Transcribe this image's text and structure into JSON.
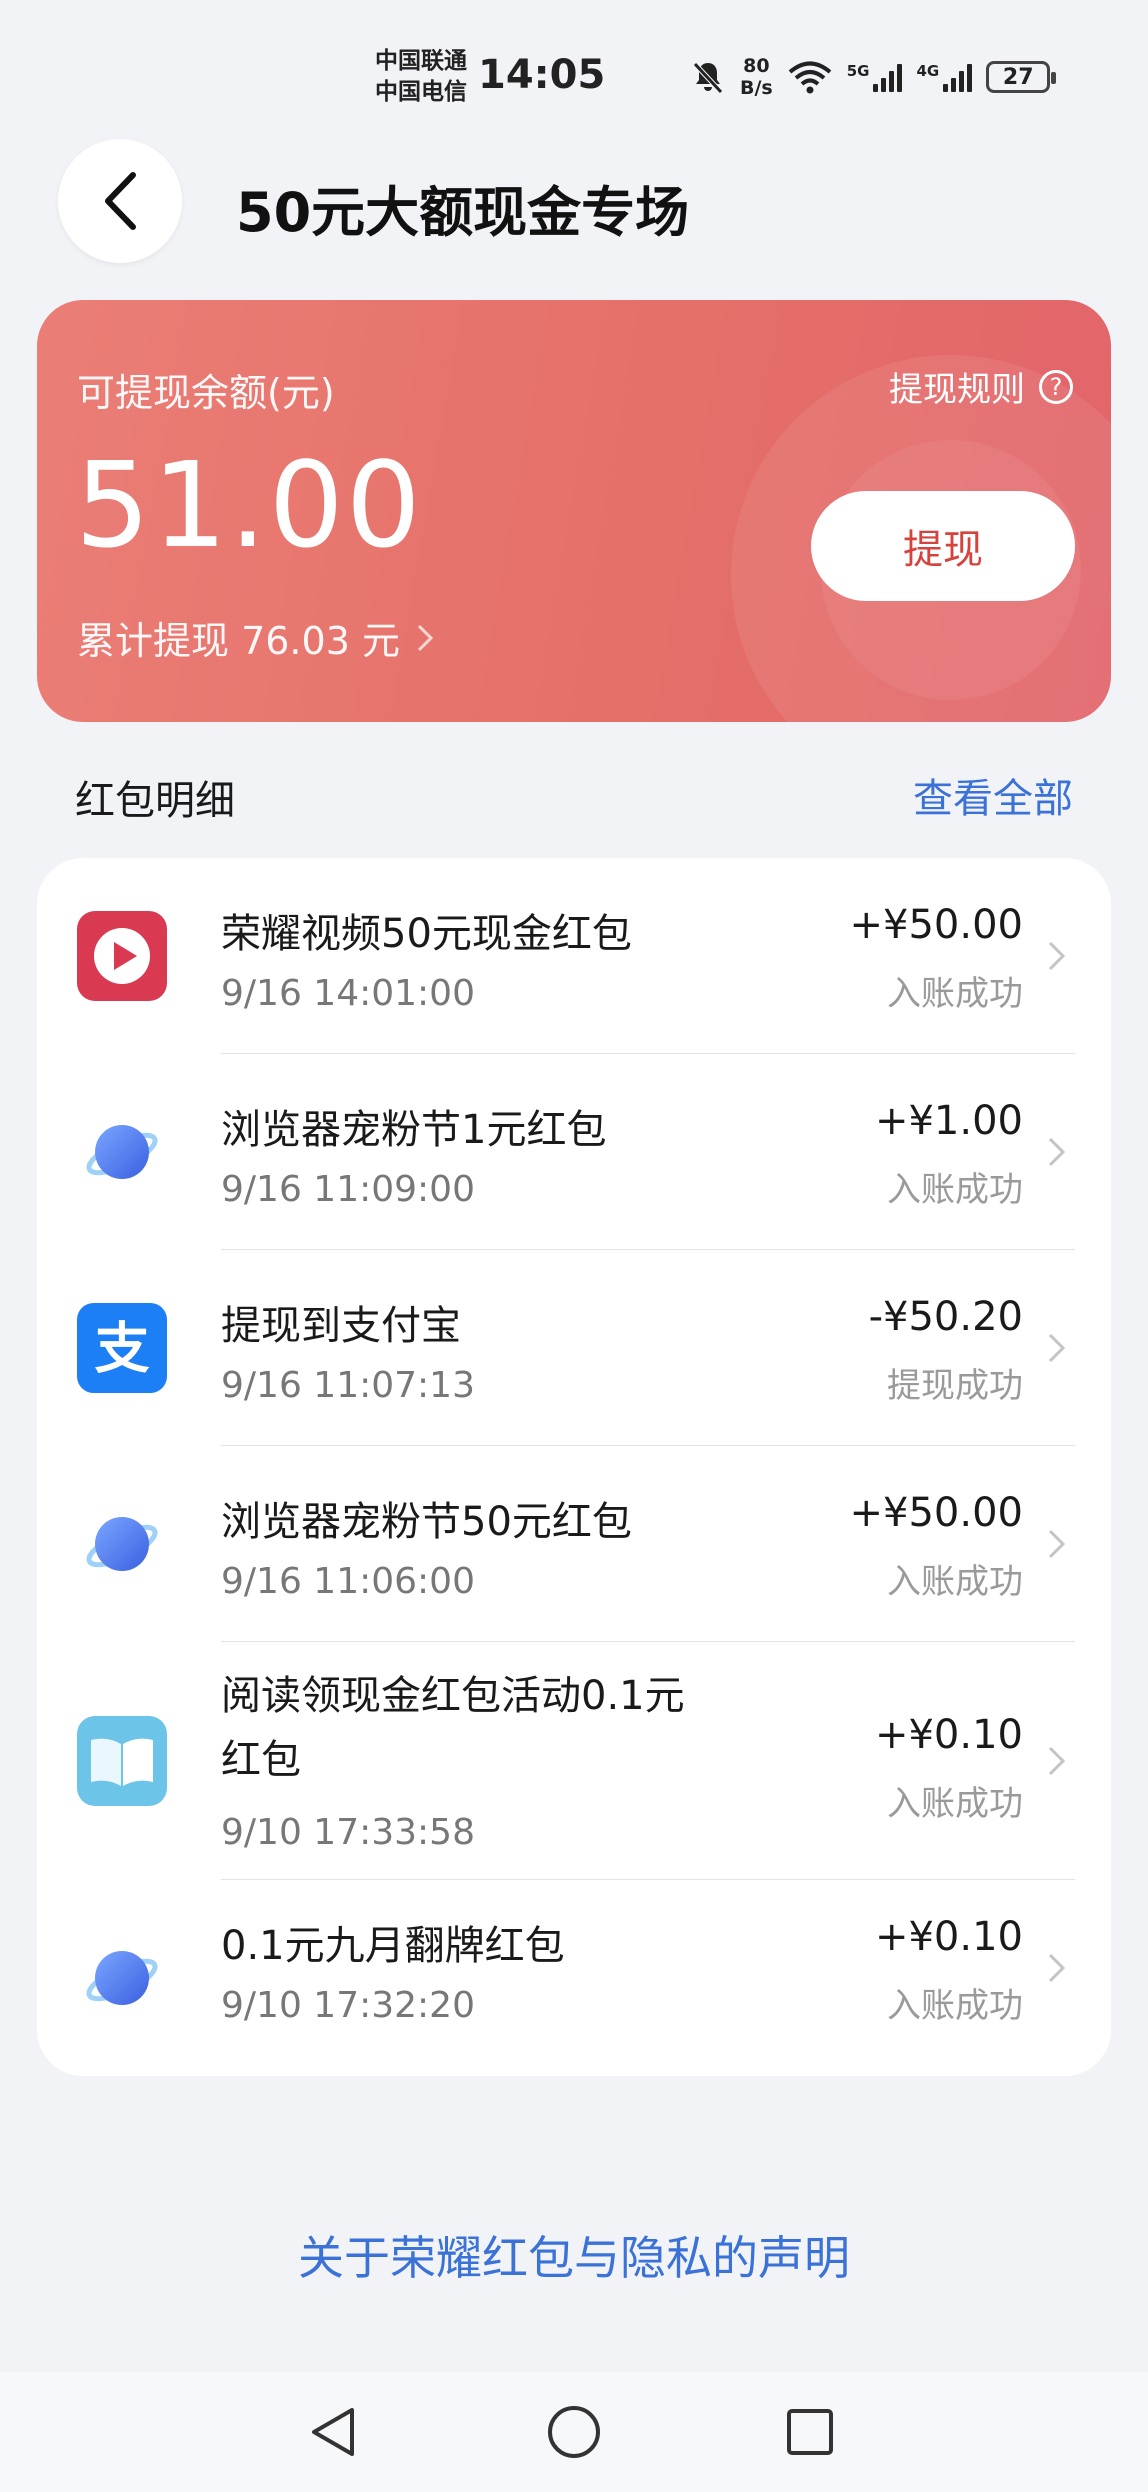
{
  "status_bar": {
    "carrier_1": "中国联通",
    "carrier_2": "中国电信",
    "time": "14:05",
    "speed_value": "80",
    "speed_unit": "B/s",
    "net_1": "5G",
    "net_2": "4G",
    "battery": "27"
  },
  "header": {
    "title": "50元大额现金专场"
  },
  "balance_card": {
    "label": "可提现余额(元)",
    "rules": "提现规则",
    "amount": "51.00",
    "total": "累计提现 76.03 元",
    "withdraw_label": "提现"
  },
  "details": {
    "title": "红包明细",
    "view_all": "查看全部",
    "items": [
      {
        "name": "荣耀视频50元现金红包",
        "time": "9/16 14:01:00",
        "amount": "+¥50.00",
        "status": "入账成功",
        "icon": "video-app-icon"
      },
      {
        "name": "浏览器宠粉节1元红包",
        "time": "9/16 11:09:00",
        "amount": "+¥1.00",
        "status": "入账成功",
        "icon": "browser-icon"
      },
      {
        "name": "提现到支付宝",
        "time": "9/16 11:07:13",
        "amount": "-¥50.20",
        "status": "提现成功",
        "icon": "alipay-icon"
      },
      {
        "name": "浏览器宠粉节50元红包",
        "time": "9/16 11:06:00",
        "amount": "+¥50.00",
        "status": "入账成功",
        "icon": "browser-icon"
      },
      {
        "name": "阅读领现金红包活动0.1元红包",
        "time": "9/10 17:33:58",
        "amount": "+¥0.10",
        "status": "入账成功",
        "icon": "book-icon"
      },
      {
        "name": "0.1元九月翻牌红包",
        "time": "9/10 17:32:20",
        "amount": "+¥0.10",
        "status": "入账成功",
        "icon": "browser-icon"
      }
    ]
  },
  "footer": {
    "privacy_link": "关于荣耀红包与隐私的声明"
  },
  "colors": {
    "card_red": "#e57069",
    "link_blue": "#3a72d8",
    "withdraw_text": "#d6423c"
  }
}
